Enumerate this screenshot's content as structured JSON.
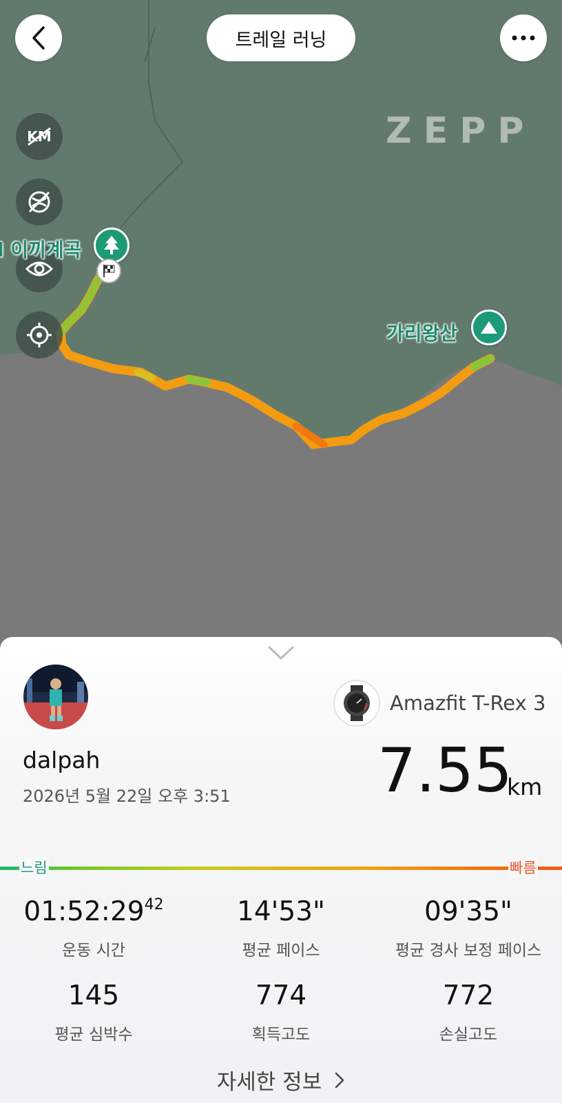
{
  "header": {
    "title": "트레일 러닝",
    "back_icon": "chevron-left-icon",
    "more_icon": "more-horizontal-icon"
  },
  "map": {
    "watermark": "ZEPP",
    "controls": [
      "km-marker-off-icon",
      "map-layer-off-icon",
      "eye-icon",
      "locate-icon"
    ],
    "start_place": "이끼계곡",
    "start_place_clipped_prefix": "l",
    "end_place": "가리왕산",
    "colors": {
      "forest": "#627a6c",
      "ground": "#7a7a7a",
      "route_slow": "#7cc22c",
      "route_fast": "#f08a14"
    }
  },
  "activity": {
    "username": "dalpah",
    "datetime": "2026년 5월 22일 오후 3:51",
    "device": "Amazfit T-Rex 3",
    "distance": "7.55",
    "distance_unit": "km"
  },
  "pace_legend": {
    "slow": "느림",
    "fast": "빠름"
  },
  "stats": [
    {
      "value": "01:52:29",
      "sup": "42",
      "label": "운동 시간"
    },
    {
      "value": "14'53\"",
      "label": "평균 페이스"
    },
    {
      "value": "09'35\"",
      "label": "평균 경사 보정 페이스"
    },
    {
      "value": "145",
      "label": "평균 심박수"
    },
    {
      "value": "774",
      "label": "획득고도"
    },
    {
      "value": "772",
      "label": "손실고도"
    }
  ],
  "footer": {
    "details_label": "자세한 정보"
  }
}
